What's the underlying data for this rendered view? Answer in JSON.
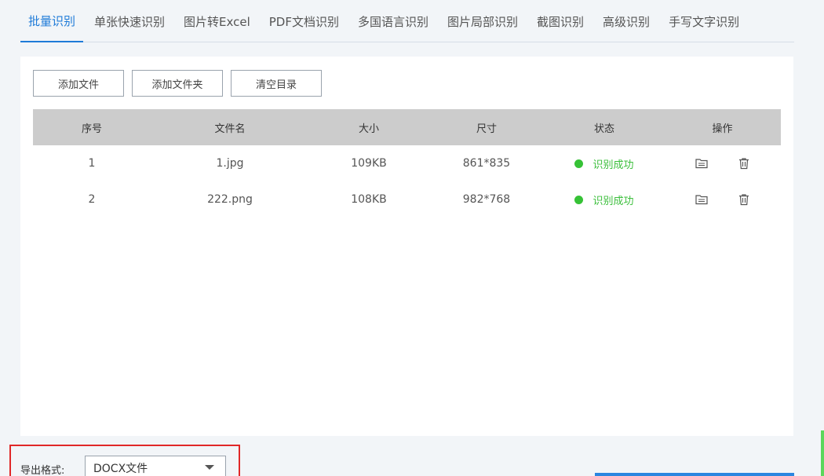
{
  "tabs": [
    {
      "label": "批量识别",
      "active": true
    },
    {
      "label": "单张快速识别"
    },
    {
      "label": "图片转Excel"
    },
    {
      "label": "PDF文档识别"
    },
    {
      "label": "多国语言识别"
    },
    {
      "label": "图片局部识别"
    },
    {
      "label": "截图识别"
    },
    {
      "label": "高级识别"
    },
    {
      "label": "手写文字识别"
    }
  ],
  "toolbar": {
    "add_file": "添加文件",
    "add_folder": "添加文件夹",
    "clear": "清空目录"
  },
  "table": {
    "headers": [
      "序号",
      "文件名",
      "大小",
      "尺寸",
      "状态",
      "操作"
    ],
    "rows": [
      {
        "index": "1",
        "name": "1.jpg",
        "size": "109KB",
        "dims": "861*835",
        "status": "识别成功"
      },
      {
        "index": "2",
        "name": "222.png",
        "size": "108KB",
        "dims": "982*768",
        "status": "识别成功"
      }
    ]
  },
  "export": {
    "label": "导出格式:",
    "format": "DOCX文件"
  },
  "colors": {
    "accent": "#1f7bd8",
    "success": "#36c236",
    "highlight_box": "#e02828"
  },
  "icons": {
    "open": "folder-open-icon",
    "delete": "trash-icon",
    "dropdown": "chevron-down-icon"
  }
}
